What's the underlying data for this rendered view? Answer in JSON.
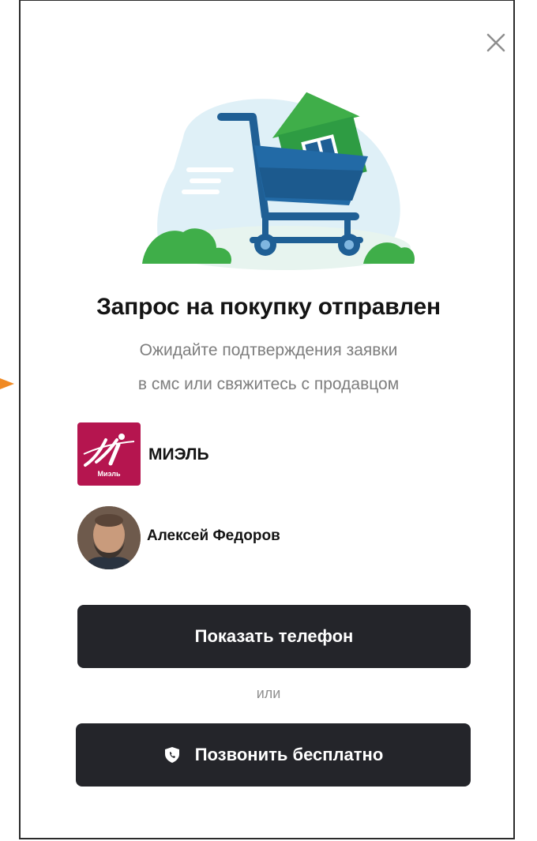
{
  "dialog": {
    "title": "Запрос на покупку отправлен",
    "subtitle_line1": "Ожидайте подтверждения заявки",
    "subtitle_line2": "в смс или свяжитесь с продавцом",
    "close_icon": "close-icon"
  },
  "seller": {
    "name": "МИЭЛЬ",
    "logo_text": "Миэль",
    "logo_color": "#b5154f"
  },
  "agent": {
    "name": "Алексей Федоров"
  },
  "actions": {
    "show_phone_label": "Показать телефон",
    "or_label": "или",
    "call_free_label": "Позвонить бесплатно",
    "call_icon": "shield-phone-icon"
  },
  "colors": {
    "button_bg": "#24252a",
    "accent_green": "#3fae49",
    "accent_blue": "#1f5f95",
    "marker": "#f08a24"
  }
}
